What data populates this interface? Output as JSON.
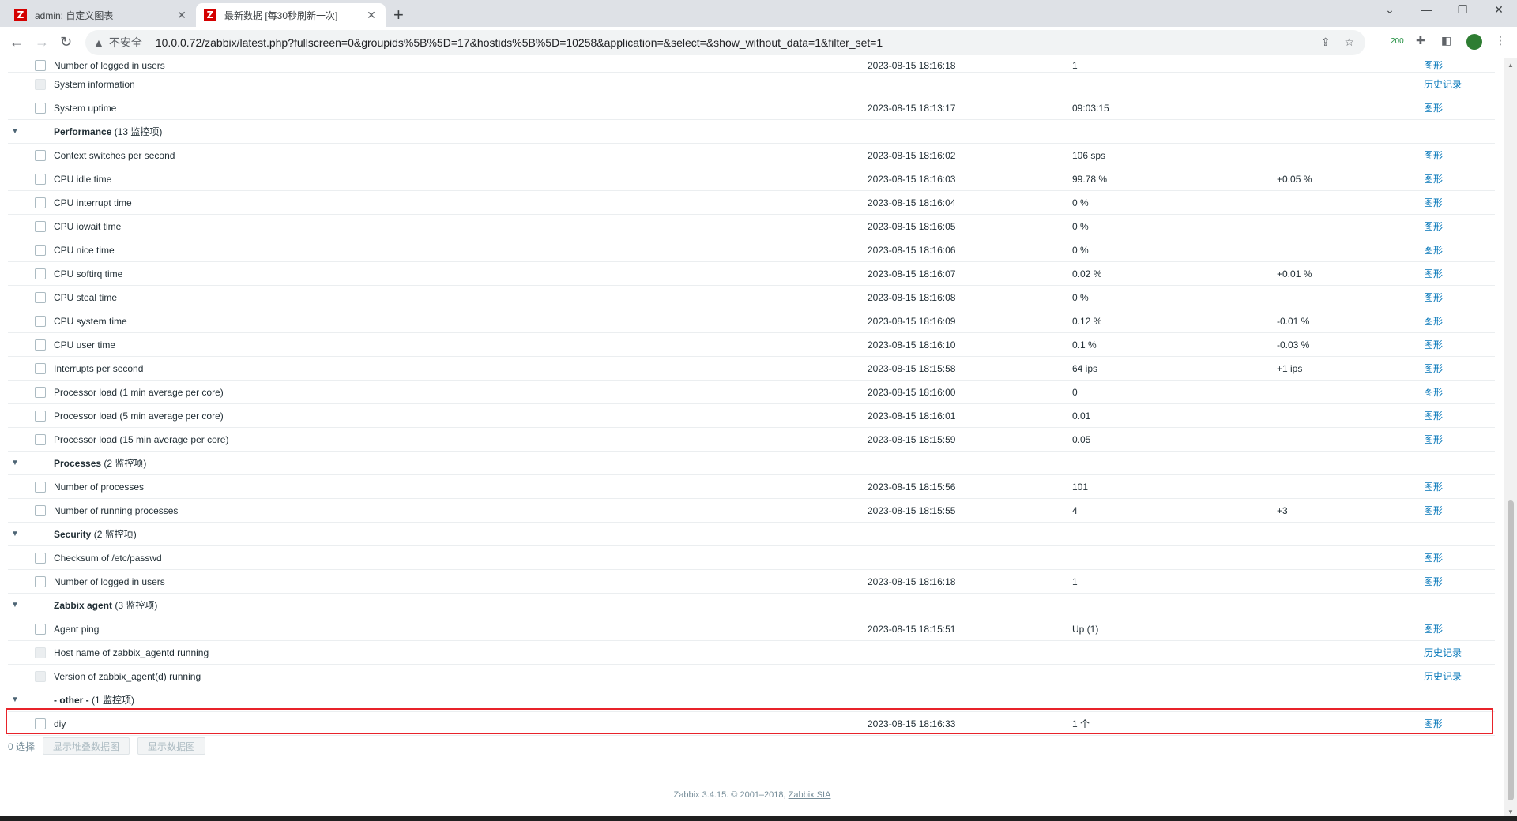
{
  "browser": {
    "tabs": [
      {
        "title": "admin: 自定义图表",
        "active": false
      },
      {
        "title": "最新数据 [每30秒刷新一次]",
        "active": true
      }
    ],
    "insecure_label": "不安全",
    "url": "10.0.0.72/zabbix/latest.php?fullscreen=0&groupids%5B%5D=17&hostids%5B%5D=10258&application=&select=&show_without_data=1&filter_set=1",
    "ext_badge": "200"
  },
  "table": {
    "partial_row": {
      "name": "Number of logged in users",
      "time": "2023-08-15 18:16:18",
      "value": "1",
      "action": "图形"
    },
    "rows": [
      {
        "type": "item",
        "name": "System information",
        "time": "",
        "value": "",
        "change": "",
        "action": "历史记录",
        "disabled": true
      },
      {
        "type": "item",
        "name": "System uptime",
        "time": "2023-08-15 18:13:17",
        "value": "09:03:15",
        "change": "",
        "action": "图形",
        "disabled": false
      },
      {
        "type": "app",
        "name": "Performance",
        "count": "(13 监控项)"
      },
      {
        "type": "item",
        "name": "Context switches per second",
        "time": "2023-08-15 18:16:02",
        "value": "106 sps",
        "change": "",
        "action": "图形",
        "disabled": false
      },
      {
        "type": "item",
        "name": "CPU idle time",
        "time": "2023-08-15 18:16:03",
        "value": "99.78 %",
        "change": "+0.05 %",
        "action": "图形",
        "disabled": false
      },
      {
        "type": "item",
        "name": "CPU interrupt time",
        "time": "2023-08-15 18:16:04",
        "value": "0 %",
        "change": "",
        "action": "图形",
        "disabled": false
      },
      {
        "type": "item",
        "name": "CPU iowait time",
        "time": "2023-08-15 18:16:05",
        "value": "0 %",
        "change": "",
        "action": "图形",
        "disabled": false
      },
      {
        "type": "item",
        "name": "CPU nice time",
        "time": "2023-08-15 18:16:06",
        "value": "0 %",
        "change": "",
        "action": "图形",
        "disabled": false
      },
      {
        "type": "item",
        "name": "CPU softirq time",
        "time": "2023-08-15 18:16:07",
        "value": "0.02 %",
        "change": "+0.01 %",
        "action": "图形",
        "disabled": false
      },
      {
        "type": "item",
        "name": "CPU steal time",
        "time": "2023-08-15 18:16:08",
        "value": "0 %",
        "change": "",
        "action": "图形",
        "disabled": false
      },
      {
        "type": "item",
        "name": "CPU system time",
        "time": "2023-08-15 18:16:09",
        "value": "0.12 %",
        "change": "-0.01 %",
        "action": "图形",
        "disabled": false
      },
      {
        "type": "item",
        "name": "CPU user time",
        "time": "2023-08-15 18:16:10",
        "value": "0.1 %",
        "change": "-0.03 %",
        "action": "图形",
        "disabled": false
      },
      {
        "type": "item",
        "name": "Interrupts per second",
        "time": "2023-08-15 18:15:58",
        "value": "64 ips",
        "change": "+1 ips",
        "action": "图形",
        "disabled": false
      },
      {
        "type": "item",
        "name": "Processor load (1 min average per core)",
        "time": "2023-08-15 18:16:00",
        "value": "0",
        "change": "",
        "action": "图形",
        "disabled": false
      },
      {
        "type": "item",
        "name": "Processor load (5 min average per core)",
        "time": "2023-08-15 18:16:01",
        "value": "0.01",
        "change": "",
        "action": "图形",
        "disabled": false
      },
      {
        "type": "item",
        "name": "Processor load (15 min average per core)",
        "time": "2023-08-15 18:15:59",
        "value": "0.05",
        "change": "",
        "action": "图形",
        "disabled": false
      },
      {
        "type": "app",
        "name": "Processes",
        "count": "(2 监控项)"
      },
      {
        "type": "item",
        "name": "Number of processes",
        "time": "2023-08-15 18:15:56",
        "value": "101",
        "change": "",
        "action": "图形",
        "disabled": false
      },
      {
        "type": "item",
        "name": "Number of running processes",
        "time": "2023-08-15 18:15:55",
        "value": "4",
        "change": "+3",
        "action": "图形",
        "disabled": false
      },
      {
        "type": "app",
        "name": "Security",
        "count": "(2 监控项)"
      },
      {
        "type": "item",
        "name": "Checksum of /etc/passwd",
        "time": "",
        "value": "",
        "change": "",
        "action": "图形",
        "disabled": false
      },
      {
        "type": "item",
        "name": "Number of logged in users",
        "time": "2023-08-15 18:16:18",
        "value": "1",
        "change": "",
        "action": "图形",
        "disabled": false
      },
      {
        "type": "app",
        "name": "Zabbix agent",
        "count": "(3 监控项)"
      },
      {
        "type": "item",
        "name": "Agent ping",
        "time": "2023-08-15 18:15:51",
        "value": "Up (1)",
        "change": "",
        "action": "图形",
        "disabled": false
      },
      {
        "type": "item",
        "name": "Host name of zabbix_agentd running",
        "time": "",
        "value": "",
        "change": "",
        "action": "历史记录",
        "disabled": true
      },
      {
        "type": "item",
        "name": "Version of zabbix_agent(d) running",
        "time": "",
        "value": "",
        "change": "",
        "action": "历史记录",
        "disabled": true
      },
      {
        "type": "app",
        "name": "- other -",
        "count": "(1 监控项)"
      },
      {
        "type": "item",
        "name": "diy",
        "time": "2023-08-15 18:16:33",
        "value": "1 个",
        "change": "",
        "action": "图形",
        "disabled": false
      }
    ]
  },
  "footer": {
    "selected_count": "0 选择",
    "btn_stacked": "显示堆叠数据图",
    "btn_graph": "显示数据图",
    "copyright": "Zabbix 3.4.15. © 2001–2018,",
    "copyright_link": "Zabbix SIA"
  }
}
